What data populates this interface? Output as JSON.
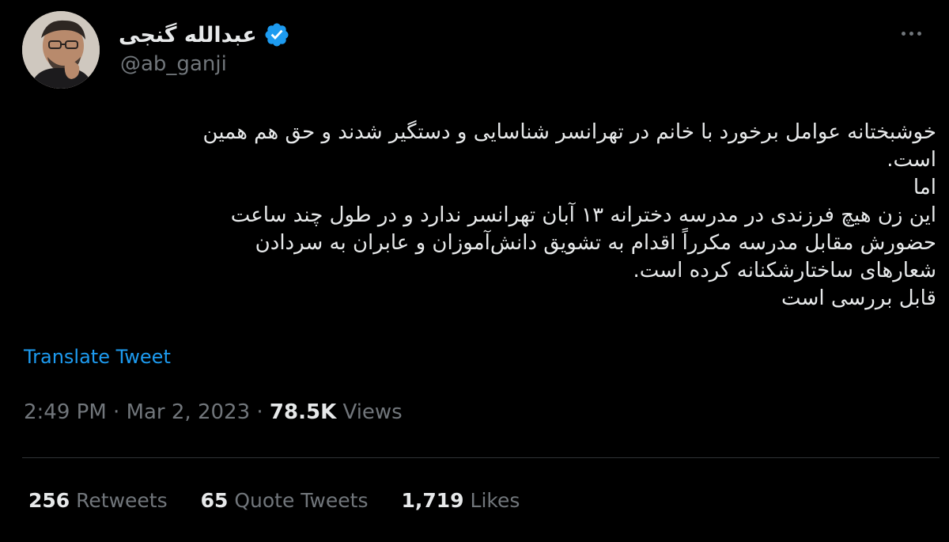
{
  "author": {
    "display_name": "عبدالله گنجی",
    "handle": "@ab_ganji",
    "verified_icon": "verified-badge-icon",
    "verified_color": "#1d9bf0"
  },
  "more_icon": "more-dots-icon",
  "tweet": {
    "lines": [
      "خوشبختانه عوامل برخورد با خانم در تهرانسر شناسایی و دستگیر شدند و حق هم همین",
      "است.",
      "اما",
      "این زن هیچ فرزندی در مدرسه دخترانه ۱۳ آبان تهرانسر ندارد و در طول چند ساعت",
      "حضورش مقابل مدرسه مکرراً اقدام به تشویق دانش‌آموزان و عابران به سردادن",
      "شعارهای ساختارشکنانه کرده است.",
      "قابل بررسی است"
    ],
    "translate_label": "Translate Tweet"
  },
  "meta": {
    "time": "2:49 PM",
    "separator": " · ",
    "date": "Mar 2, 2023",
    "views_count": "78.5K",
    "views_label": " Views"
  },
  "stats": {
    "retweets": {
      "count": "256",
      "label": " Retweets"
    },
    "quote_tweets": {
      "count": "65",
      "label": " Quote Tweets"
    },
    "likes": {
      "count": "1,719",
      "label": " Likes"
    }
  },
  "colors": {
    "background": "#000000",
    "text_primary": "#e7e9ea",
    "text_secondary": "#71767b",
    "link": "#1d9bf0",
    "divider": "#2f3336"
  }
}
